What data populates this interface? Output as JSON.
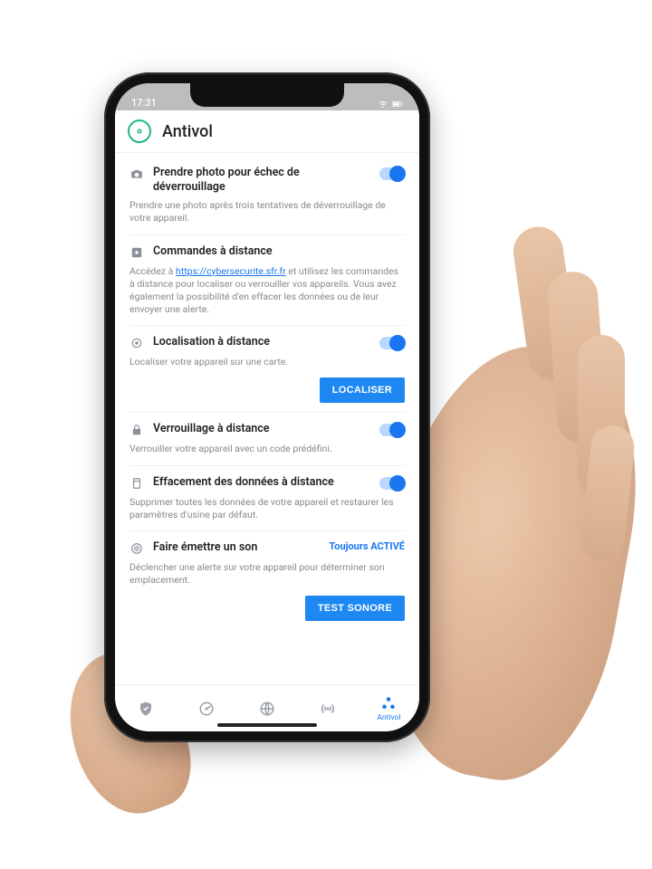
{
  "statusbar": {
    "time": "17:31"
  },
  "header": {
    "title": "Antivol"
  },
  "sections": {
    "photo": {
      "title": "Prendre photo pour échec de déverrouillage",
      "desc": "Prendre une photo après trois tentatives de déverrouillage de votre appareil."
    },
    "remote_cmd": {
      "title": "Commandes à distance",
      "desc_prefix": "Accédez à ",
      "link_text": "https://cybersecurite.sfr.fr",
      "desc_suffix": " et utilisez les commandes à distance pour localiser ou verrouiller vos appareils. Vous avez également la possibilité d'en effacer les données ou de leur envoyer une alerte."
    },
    "locate": {
      "title": "Localisation à distance",
      "desc": "Localiser votre appareil sur une carte.",
      "button": "LOCALISER"
    },
    "lock": {
      "title": "Verrouillage à distance",
      "desc": "Verrouiller votre appareil avec un code prédéfini."
    },
    "erase": {
      "title": "Effacement des données à distance",
      "desc": "Supprimer toutes les données de votre appareil et restaurer les paramètres d'usine par défaut."
    },
    "sound": {
      "title": "Faire émettre un son",
      "state": "Toujours ACTIVÉ",
      "desc": "Déclencher une alerte sur votre appareil pour déterminer son emplacement.",
      "button": "TEST SONORE"
    }
  },
  "bottomnav": {
    "active_label": "Antivol"
  }
}
